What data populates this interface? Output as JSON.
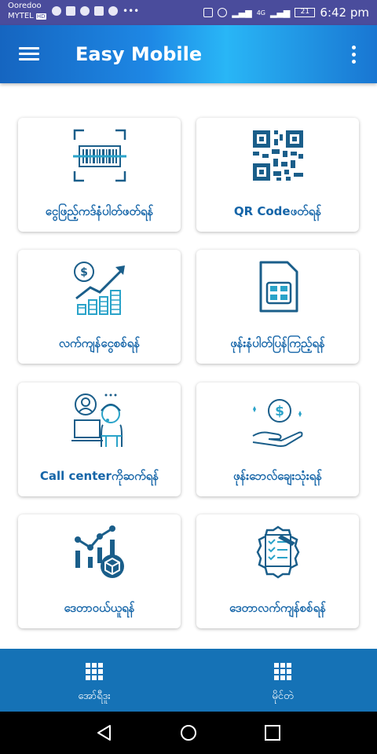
{
  "status_bar": {
    "carrier1": "Ooredoo",
    "carrier2": "MYTEL",
    "carrier2_badge": "HD",
    "network": "4G",
    "battery": "21",
    "time": "6:42 pm"
  },
  "app_bar": {
    "title": "Easy Mobile"
  },
  "grid": [
    {
      "label": "ငွေဖြည့်ကဒ်နံပါတ်ဖတ်ရန်",
      "icon": "barcode-scan-icon"
    },
    {
      "label": "QR Codeဖတ်ရန်",
      "icon": "qr-code-icon"
    },
    {
      "label": "လက်ကျန်ငွေစစ်ရန်",
      "icon": "balance-chart-icon"
    },
    {
      "label": "ဖုန်းနံပါတ်ပြန်ကြည့်ရန်",
      "icon": "sim-card-icon"
    },
    {
      "label": "Call centerကိုဆက်ရန်",
      "icon": "call-center-icon"
    },
    {
      "label": "ဖုန်းဘေလ်ချေးသုံးရန်",
      "icon": "loan-money-icon"
    },
    {
      "label": "ဒေတာဝယ်ယူရန်",
      "icon": "data-package-icon"
    },
    {
      "label": "ဒေတာလက်ကျန်စစ်ရန်",
      "icon": "data-check-icon"
    }
  ],
  "bottom_nav": [
    {
      "label": "အော်ရီဒူး",
      "icon": "grid-icon"
    },
    {
      "label": "မိုင်တဲ",
      "icon": "grid-icon"
    }
  ],
  "colors": {
    "status_bar": "#4a4c9c",
    "app_bar_start": "#1565c0",
    "app_bar_highlight": "#29b6f6",
    "accent": "#1565a8",
    "bottom_nav": "#1572b6"
  }
}
